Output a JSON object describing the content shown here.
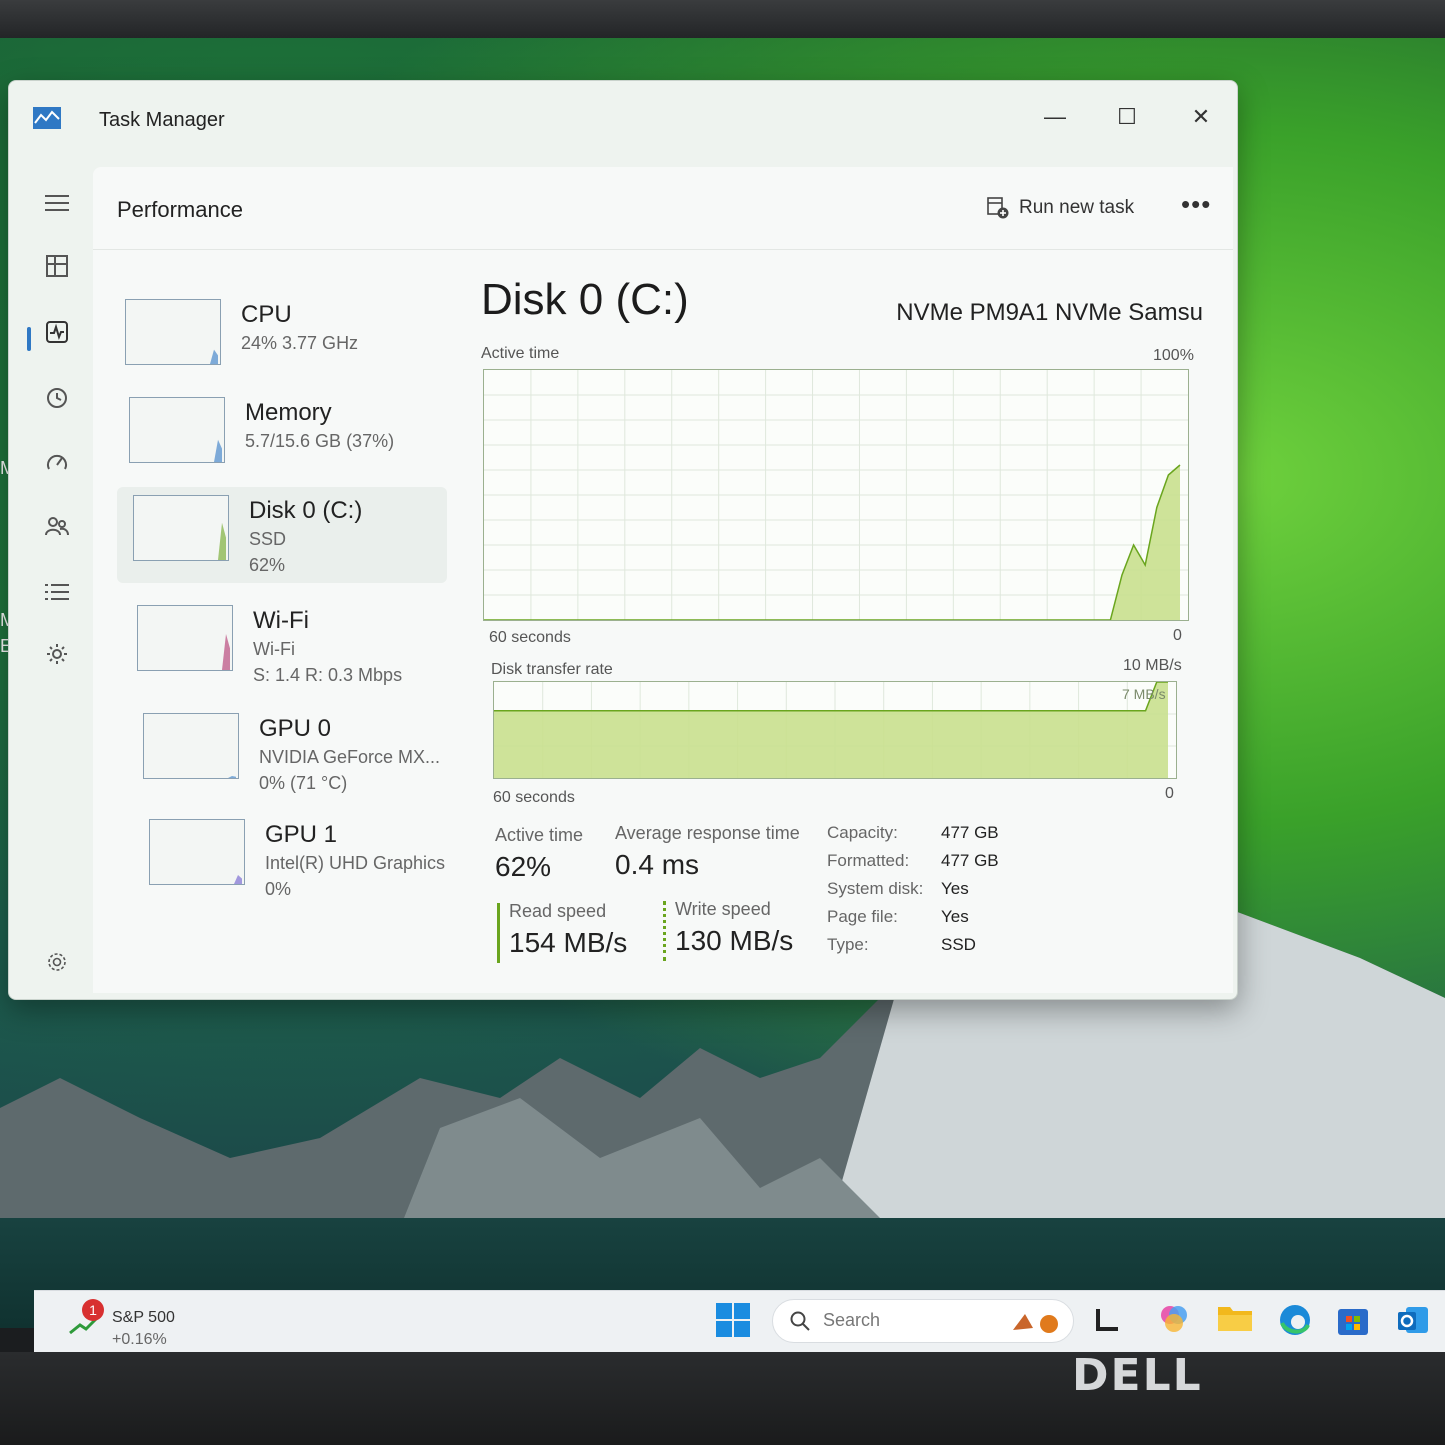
{
  "window": {
    "title": "Task Manager",
    "controls": {
      "minimize": "—",
      "maximize": "☐",
      "close": "✕"
    }
  },
  "command_bar": {
    "page_title": "Performance",
    "run_new_task": "Run new task",
    "more": "•••"
  },
  "nav_icons": [
    "menu-icon",
    "processes-icon",
    "performance-icon",
    "app-history-icon",
    "startup-apps-icon",
    "users-icon",
    "details-icon",
    "services-icon",
    "settings-icon"
  ],
  "devices": [
    {
      "name": "CPU",
      "line1": "24% 3.77 GHz",
      "line2": "",
      "value": 0.24,
      "color": "#2f78c4"
    },
    {
      "name": "Memory",
      "line1": "5.7/15.6 GB (37%)",
      "line2": "",
      "value": 0.37,
      "color": "#2f78c4"
    },
    {
      "name": "Disk 0 (C:)",
      "line1": "SSD",
      "line2": "62%",
      "value": 0.62,
      "color": "#6aa51e",
      "selected": true
    },
    {
      "name": "Wi-Fi",
      "line1": "Wi-Fi",
      "line2": "S: 1.4 R: 0.3 Mbps",
      "value": 0.6,
      "color": "#b0306a"
    },
    {
      "name": "GPU 0",
      "line1": "NVIDIA GeForce MX...",
      "line2": "0%  (71 °C)",
      "value": 0.0,
      "color": "#2f78c4"
    },
    {
      "name": "GPU 1",
      "line1": "Intel(R) UHD Graphics",
      "line2": "0%",
      "value": 0.15,
      "color": "#6a5acd"
    }
  ],
  "detail": {
    "title": "Disk 0 (C:)",
    "model": "NVMe PM9A1 NVMe Samsu",
    "active_time_graph": {
      "label": "Active time",
      "max_label": "100%",
      "xlabel": "60 seconds",
      "min_label": "0"
    },
    "transfer_graph": {
      "label": "Disk transfer rate",
      "max_label": "10 MB/s",
      "inner_label": "7 MB/s",
      "xlabel": "60 seconds",
      "min_label": "0"
    },
    "stats": {
      "active_time_label": "Active time",
      "active_time_value": "62%",
      "avg_resp_label": "Average response time",
      "avg_resp_value": "0.4 ms",
      "read_label": "Read speed",
      "read_value": "154 MB/s",
      "write_label": "Write speed",
      "write_value": "130 MB/s"
    },
    "properties": [
      {
        "key": "Capacity:",
        "value": "477 GB"
      },
      {
        "key": "Formatted:",
        "value": "477 GB"
      },
      {
        "key": "System disk:",
        "value": "Yes"
      },
      {
        "key": "Page file:",
        "value": "Yes"
      },
      {
        "key": "Type:",
        "value": "SSD"
      }
    ]
  },
  "chart_data": [
    {
      "type": "area",
      "title": "Active time",
      "ylim": [
        0,
        100
      ],
      "xlabel": "60 seconds",
      "x": [
        0,
        54,
        55,
        56,
        57,
        58,
        59,
        60
      ],
      "values": [
        0,
        0,
        18,
        30,
        22,
        45,
        58,
        62
      ]
    },
    {
      "type": "area",
      "title": "Disk transfer rate",
      "ylim": [
        0,
        10
      ],
      "xlabel": "60 seconds",
      "x": [
        0,
        58,
        59,
        60
      ],
      "values": [
        7,
        7,
        10,
        10
      ]
    }
  ],
  "taskbar": {
    "widget_title": "S&P 500",
    "widget_value": "+0.16%",
    "widget_badge": "1",
    "search_placeholder": "Search"
  },
  "brand": "DELL",
  "desktop_fragments": [
    "Mic",
    "Ed",
    "Mic",
    "Edge"
  ]
}
